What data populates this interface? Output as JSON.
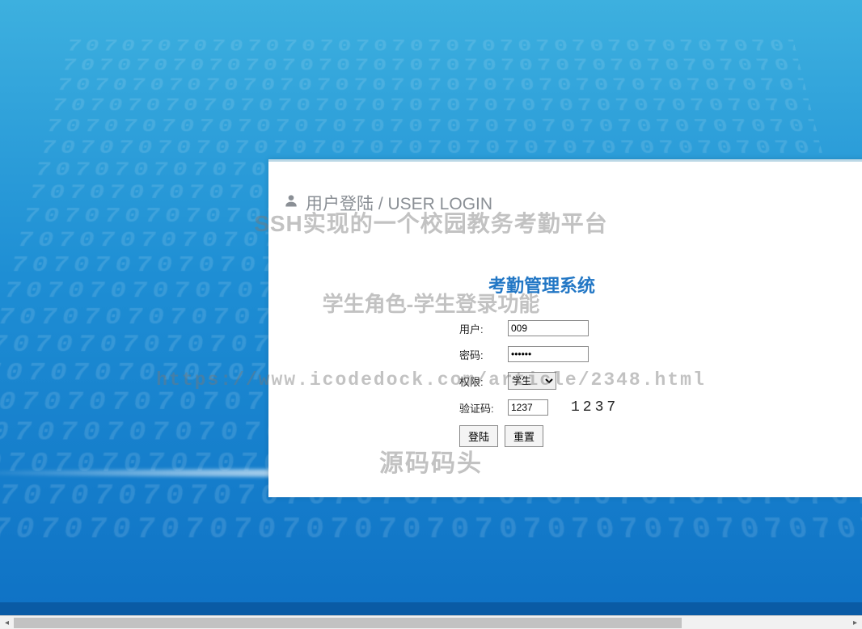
{
  "header": {
    "title": "用户登陆 / USER LOGIN"
  },
  "system_title": "考勤管理系统",
  "form": {
    "user_label": "用户:",
    "user_value": "009",
    "password_label": "密码:",
    "password_value": "••••••",
    "role_label": "权限:",
    "role_selected": "学生",
    "captcha_label": "验证码:",
    "captcha_value": "1237",
    "captcha_display": "1237",
    "login_label": "登陆",
    "reset_label": "重置"
  },
  "watermarks": {
    "title": "SSH实现的一个校园教务考勤平台",
    "subtitle": "学生角色-学生登录功能",
    "url": "https://www.icodedock.com/article/2348.html",
    "brand": "源码码头"
  },
  "bg_binary": "7070707070707070707070707070707070707070707070707070707070"
}
